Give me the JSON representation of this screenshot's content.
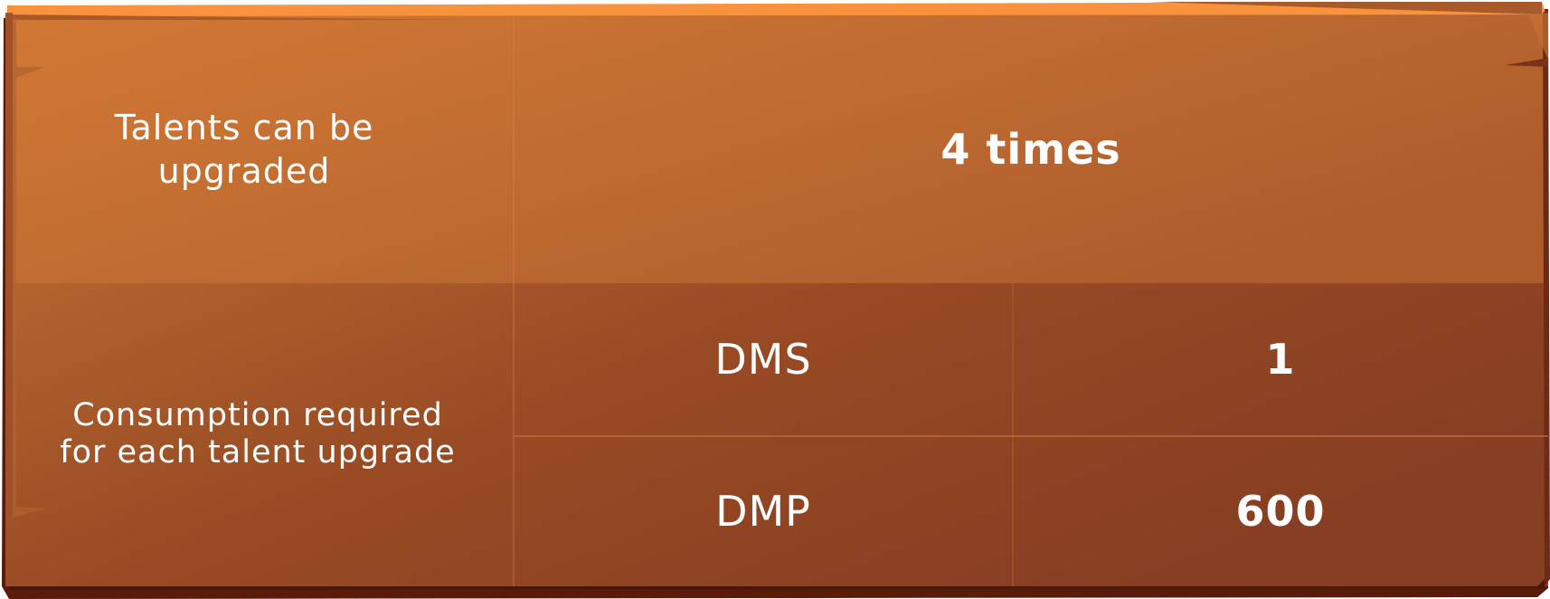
{
  "table": {
    "row1": {
      "label": "Talents can be upgraded",
      "value": "4 times"
    },
    "row2": {
      "label": "Consumption required for each talent upgrade",
      "items": [
        {
          "name": "DMS",
          "amount": "1"
        },
        {
          "name": "DMP",
          "amount": "600"
        }
      ]
    }
  },
  "colors": {
    "top_row": "#cb7234",
    "bottom_row": "#9a4a24",
    "bottom_right": "#883f22",
    "rim": "#f8923c",
    "shadow": "#5a1c0a"
  }
}
